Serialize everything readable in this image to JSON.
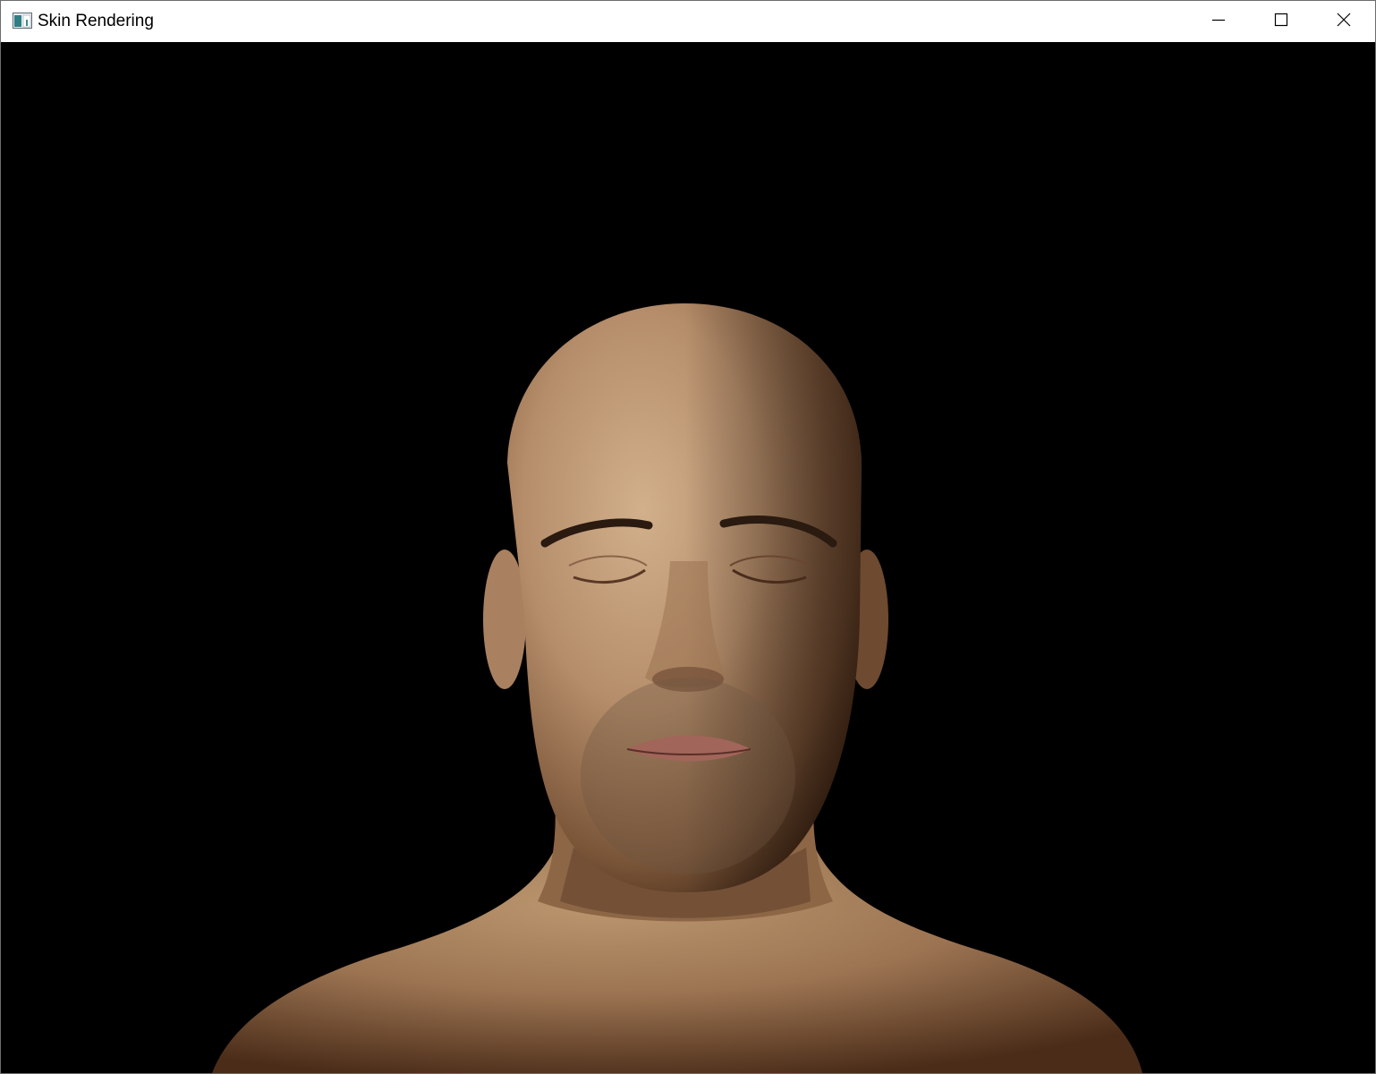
{
  "window": {
    "title": "Skin Rendering",
    "app_icon": "app-window-icon",
    "controls": {
      "minimize_icon": "minimize-icon",
      "maximize_icon": "maximize-icon",
      "close_icon": "close-icon"
    }
  },
  "viewport": {
    "background_color": "#000000",
    "subject": "render-head-bust",
    "skin_color": "#b58d6a"
  }
}
